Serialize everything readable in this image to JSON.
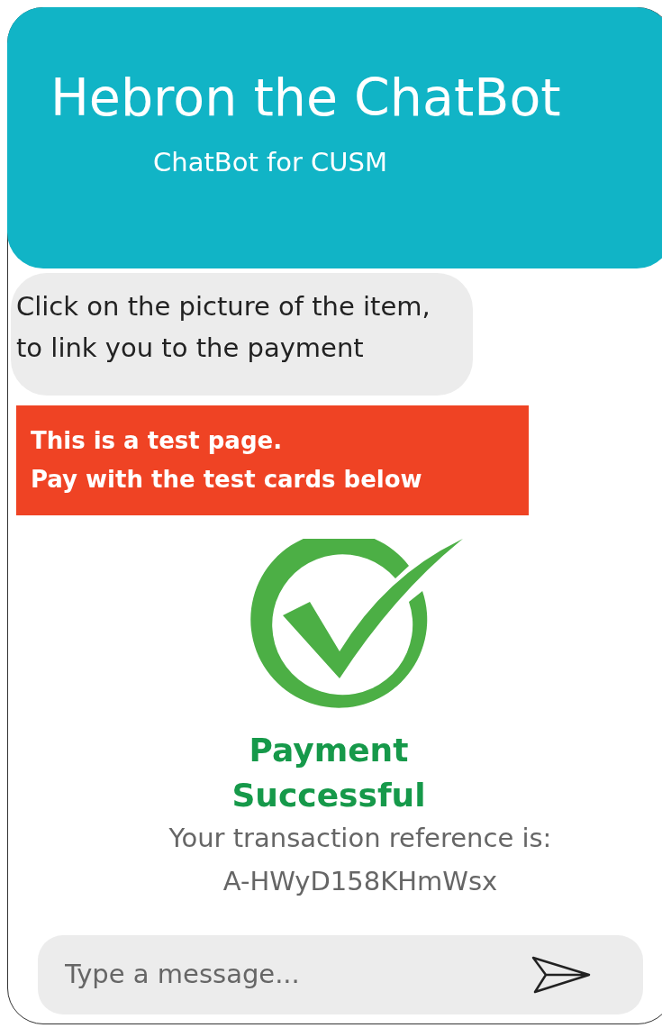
{
  "header": {
    "title": "Hebron the ChatBot",
    "subtitle": "ChatBot for CUSM"
  },
  "messages": [
    {
      "kind": "bot",
      "text": "Click on the picture of the item, to link you to the payment"
    },
    {
      "kind": "notice",
      "lines": [
        "This is a test page.",
        "Pay with the test cards below"
      ]
    },
    {
      "kind": "result",
      "title_lines": [
        "Payment",
        "Successful"
      ],
      "detail_lines": [
        "Your transaction reference is:",
        "A-HWyD158KHmWsx"
      ]
    }
  ],
  "composer": {
    "placeholder": "Type a message..."
  }
}
